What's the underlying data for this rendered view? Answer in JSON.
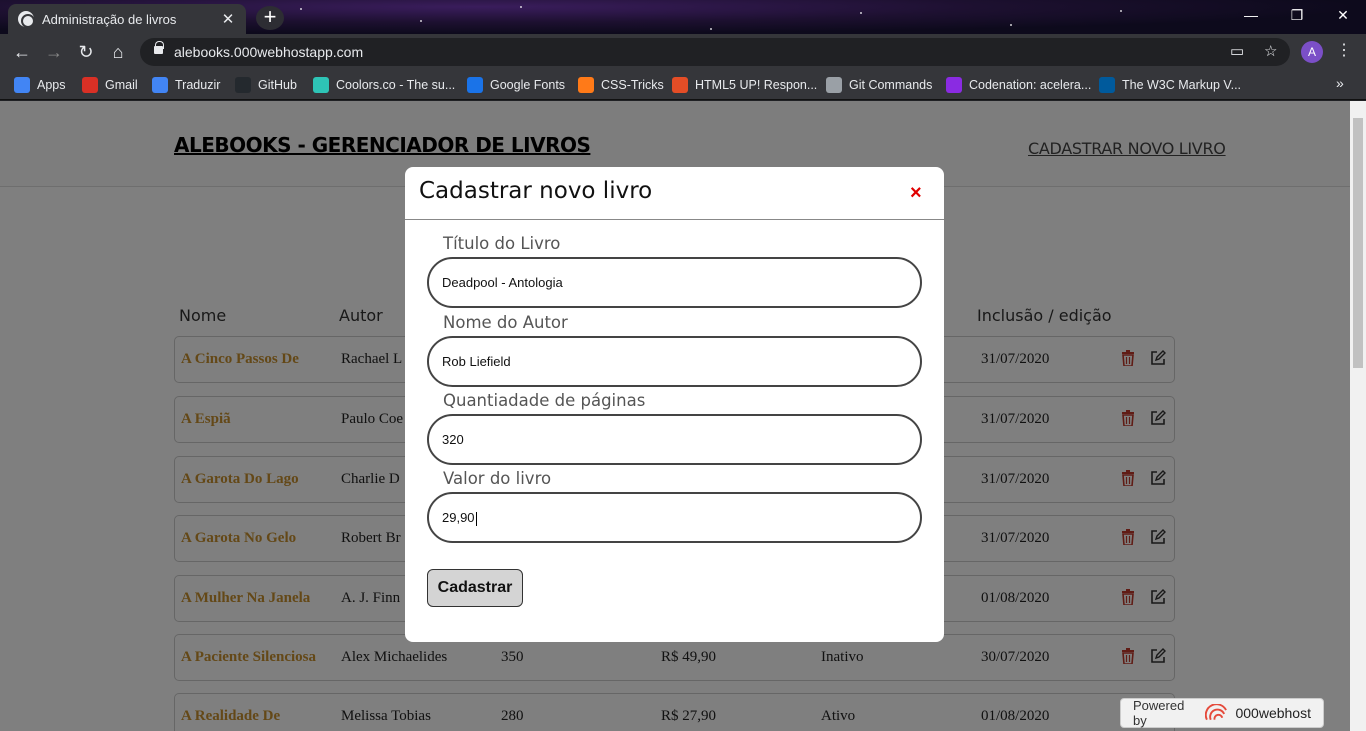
{
  "browser": {
    "tab_title": "Administração de livros",
    "url": "alebooks.000webhostapp.com",
    "avatar_letter": "A",
    "bookmarks": [
      {
        "label": "Apps",
        "color": "#4285f4"
      },
      {
        "label": "Gmail",
        "color": "#d93025"
      },
      {
        "label": "Traduzir",
        "color": "#4285f4"
      },
      {
        "label": "GitHub",
        "color": "#24292e"
      },
      {
        "label": "Coolors.co - The su...",
        "color": "#2ec4b6"
      },
      {
        "label": "Google Fonts",
        "color": "#1a73e8"
      },
      {
        "label": "CSS-Tricks",
        "color": "#ff7a18"
      },
      {
        "label": "HTML5 UP! Respon...",
        "color": "#e44d26"
      },
      {
        "label": "Git Commands",
        "color": "#9aa0a6"
      },
      {
        "label": "Codenation: acelera...",
        "color": "#8a2be2"
      },
      {
        "label": "The W3C Markup V...",
        "color": "#005a9c"
      }
    ]
  },
  "site": {
    "logo": "ALEBOOKS - GERENCIADOR DE LIVROS",
    "header_link": "CADASTRAR NOVO LIVRO",
    "columns": {
      "nome": "Nome",
      "autor": "Autor",
      "inclusao": "Inclusão / edição"
    },
    "rows": [
      {
        "title": "A Cinco Passos De",
        "author": "Rachael L",
        "pages": "",
        "price": "",
        "status": "",
        "date": "31/07/2020"
      },
      {
        "title": "A Espiã",
        "author": "Paulo Coe",
        "pages": "",
        "price": "",
        "status": "",
        "date": "31/07/2020"
      },
      {
        "title": "A Garota Do Lago",
        "author": "Charlie D",
        "pages": "",
        "price": "",
        "status": "",
        "date": "31/07/2020"
      },
      {
        "title": "A Garota No Gelo",
        "author": "Robert Br",
        "pages": "",
        "price": "",
        "status": "",
        "date": "31/07/2020"
      },
      {
        "title": "A Mulher Na Janela",
        "author": "A. J. Finn",
        "pages": "",
        "price": "",
        "status": "",
        "date": "01/08/2020"
      },
      {
        "title": "A Paciente Silenciosa",
        "author": "Alex Michaelides",
        "pages": "350",
        "price": "R$ 49,90",
        "status": "Inativo",
        "date": "30/07/2020"
      },
      {
        "title": "A Realidade De",
        "author": "Melissa Tobias",
        "pages": "280",
        "price": "R$ 27,90",
        "status": "Ativo",
        "date": "01/08/2020"
      }
    ],
    "powered_by": "Powered by",
    "powered_brand": "000webhost"
  },
  "modal": {
    "title": "Cadastrar novo livro",
    "close": "×",
    "fields": [
      {
        "label": "Título do Livro",
        "value": "Deadpool - Antologia"
      },
      {
        "label": "Nome do Autor",
        "value": "Rob Liefield"
      },
      {
        "label": "Quantiadade de páginas",
        "value": "320"
      },
      {
        "label": "Valor do livro",
        "value": "29,90"
      }
    ],
    "submit": "Cadastrar"
  },
  "colors": {
    "title_link": "#c8912e",
    "close": "#e00000",
    "trash": "#c0392b"
  }
}
